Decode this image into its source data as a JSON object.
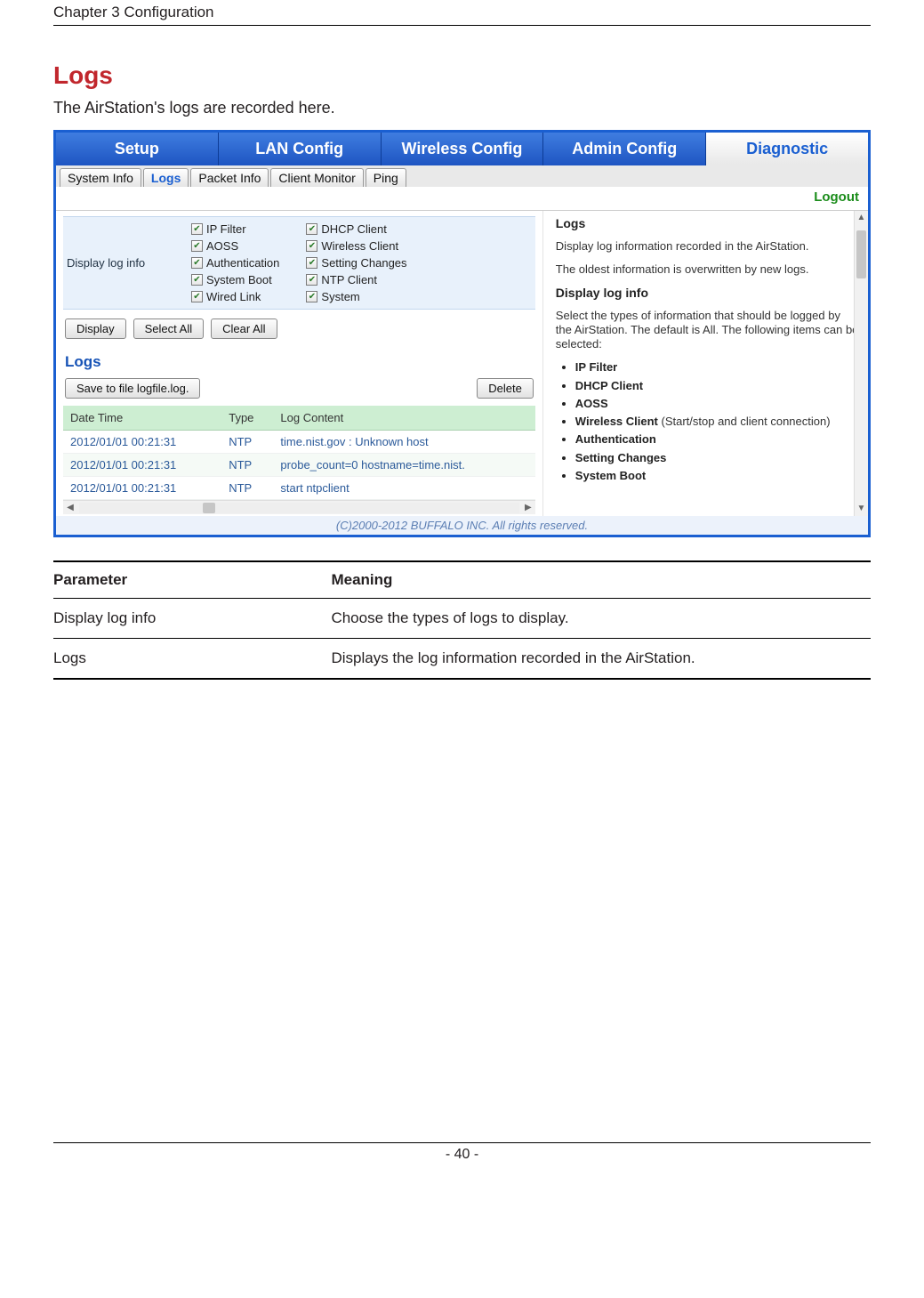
{
  "page": {
    "chapter_header": "Chapter 3  Configuration",
    "section_title": "Logs",
    "section_subtitle": "The AirStation's logs are recorded here.",
    "page_number": "- 40 -"
  },
  "ui": {
    "main_tabs": [
      "Setup",
      "LAN Config",
      "Wireless Config",
      "Admin Config",
      "Diagnostic"
    ],
    "main_tab_active_index": 4,
    "sub_tabs": [
      "System Info",
      "Logs",
      "Packet Info",
      "Client Monitor",
      "Ping"
    ],
    "sub_tab_active_index": 1,
    "logout": "Logout",
    "display_log_info": {
      "label": "Display log info",
      "col1": [
        "IP Filter",
        "AOSS",
        "Authentication",
        "System Boot",
        "Wired Link"
      ],
      "col2": [
        "DHCP Client",
        "Wireless Client",
        "Setting Changes",
        "NTP Client",
        "System"
      ]
    },
    "buttons": {
      "display": "Display",
      "select_all": "Select All",
      "clear_all": "Clear All"
    },
    "logs_section": {
      "heading": "Logs",
      "save_btn": "Save to file logfile.log.",
      "delete_btn": "Delete",
      "columns": [
        "Date Time",
        "Type",
        "Log Content"
      ],
      "rows": [
        {
          "dt": "2012/01/01 00:21:31",
          "type": "NTP",
          "content": "time.nist.gov : Unknown host"
        },
        {
          "dt": "2012/01/01 00:21:31",
          "type": "NTP",
          "content": "probe_count=0 hostname=time.nist."
        },
        {
          "dt": "2012/01/01 00:21:31",
          "type": "NTP",
          "content": "start ntpclient"
        }
      ]
    },
    "help_pane": {
      "h1": "Logs",
      "p1": "Display log information recorded in the AirStation.",
      "p2": "The oldest information is overwritten by new logs.",
      "h2": "Display log info",
      "p3": "Select the types of information that should be logged by the AirStation. The default is All. The following items can be selected:",
      "items": [
        "IP Filter",
        "DHCP Client",
        "AOSS",
        "Wireless Client",
        "Authentication",
        "Setting Changes",
        "System Boot"
      ],
      "wc_note": " (Start/stop and client connection)"
    },
    "copyright": "(C)2000-2012 BUFFALO INC. All rights reserved."
  },
  "param_table": {
    "headers": [
      "Parameter",
      "Meaning"
    ],
    "rows": [
      {
        "p": "Display log info",
        "m": "Choose the types of logs to display."
      },
      {
        "p": "Logs",
        "m": "Displays the log information recorded in the AirStation."
      }
    ]
  }
}
